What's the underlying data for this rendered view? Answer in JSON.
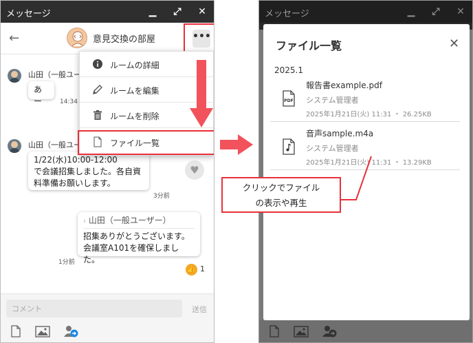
{
  "left_window": {
    "title": "メッセージ",
    "room_title": "意見交換の部屋",
    "more_label": "•••",
    "messages": [
      {
        "sender": "山田（一般ユー",
        "text": "あー",
        "time": "14:34"
      },
      {
        "sender": "山田（一般ユー",
        "text_lines": [
          "1/22(水)10:00-12:00",
          "で会議招集しました。各自資",
          "料準備お願いします。"
        ],
        "time": "3分前"
      },
      {
        "reply_to": "山田（一般ユーザー）",
        "text_lines": [
          "招集ありがとうございます。",
          "会議室A101を確保しました。"
        ],
        "time": "1分前",
        "likes": "1"
      }
    ],
    "menu": [
      {
        "label": "ルームの詳細",
        "icon": "info-icon"
      },
      {
        "label": "ルームを編集",
        "icon": "pencil-icon"
      },
      {
        "label": "ルームを削除",
        "icon": "trash-icon"
      },
      {
        "label": "ファイル一覧",
        "icon": "file-icon"
      }
    ],
    "comment_placeholder": "コメント",
    "send_label": "送信"
  },
  "right_window": {
    "title": "メッセージ",
    "modal_title": "ファイル一覧",
    "group_label": "2025.1",
    "files": [
      {
        "name": "報告書example.pdf",
        "owner": "システム管理者",
        "meta": "2025年1月21日(火) 11:31 ・ 26.25KB",
        "icon": "pdf-file-icon"
      },
      {
        "name": "音声sample.m4a",
        "owner": "システム管理者",
        "meta": "2025年1月21日(火) 11:31 ・ 13.29KB",
        "icon": "audio-file-icon"
      }
    ]
  },
  "callout": {
    "line1": "クリックでファイル",
    "line2": "の表示や再生"
  },
  "colors": {
    "highlight": "#e8303a",
    "titlebar": "#2e2e2e",
    "like": "#f4a623"
  }
}
